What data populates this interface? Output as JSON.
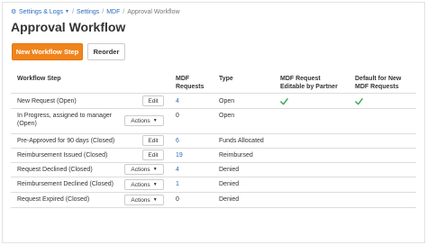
{
  "breadcrumb": {
    "root": "Settings & Logs",
    "items": [
      "Settings",
      "MDF"
    ],
    "current": "Approval Workflow",
    "separator": "/"
  },
  "page": {
    "title": "Approval Workflow"
  },
  "toolbar": {
    "new_step_label": "New Workflow Step",
    "reorder_label": "Reorder"
  },
  "table": {
    "headers": {
      "step": "Workflow Step",
      "requests_line1": "MDF",
      "requests_line2": "Requests",
      "type": "Type",
      "editable_line1": "MDF Request",
      "editable_line2": "Editable by Partner",
      "default_line1": "Default for New",
      "default_line2": "MDF Requests"
    },
    "rows": [
      {
        "step_line1": "New Request (Open)",
        "step_line2": "",
        "action": "Edit",
        "requests": "4",
        "type": "Open",
        "editable": true,
        "default": true
      },
      {
        "step_line1": "In Progress, assigned to manager",
        "step_line2": "(Open)",
        "action": "Actions",
        "requests": "0",
        "type": "Open",
        "editable": false,
        "default": false
      },
      {
        "step_line1": "Pre-Approved for 90 days (Closed)",
        "step_line2": "",
        "action": "Edit",
        "requests": "6",
        "type": "Funds Allocated",
        "editable": false,
        "default": false
      },
      {
        "step_line1": "Reimbursement Issued (Closed)",
        "step_line2": "",
        "action": "Edit",
        "requests": "19",
        "type": "Reimbursed",
        "editable": false,
        "default": false
      },
      {
        "step_line1": "Request Declined (Closed)",
        "step_line2": "",
        "action": "Actions",
        "requests": "4",
        "type": "Denied",
        "editable": false,
        "default": false
      },
      {
        "step_line1": "Reimbursement Declined (Closed)",
        "step_line2": "",
        "action": "Actions",
        "requests": "1",
        "type": "Denied",
        "editable": false,
        "default": false
      },
      {
        "step_line1": "Request Expired (Closed)",
        "step_line2": "",
        "action": "Actions",
        "requests": "0",
        "type": "Denied",
        "editable": false,
        "default": false
      }
    ]
  },
  "colors": {
    "accent": "#f0841c",
    "link": "#2a6ebb",
    "check": "#3aa655"
  },
  "icons": {
    "breadcrumb_root": "gear-icon",
    "dropdown": "caret-down-icon",
    "flag": "check-icon"
  }
}
